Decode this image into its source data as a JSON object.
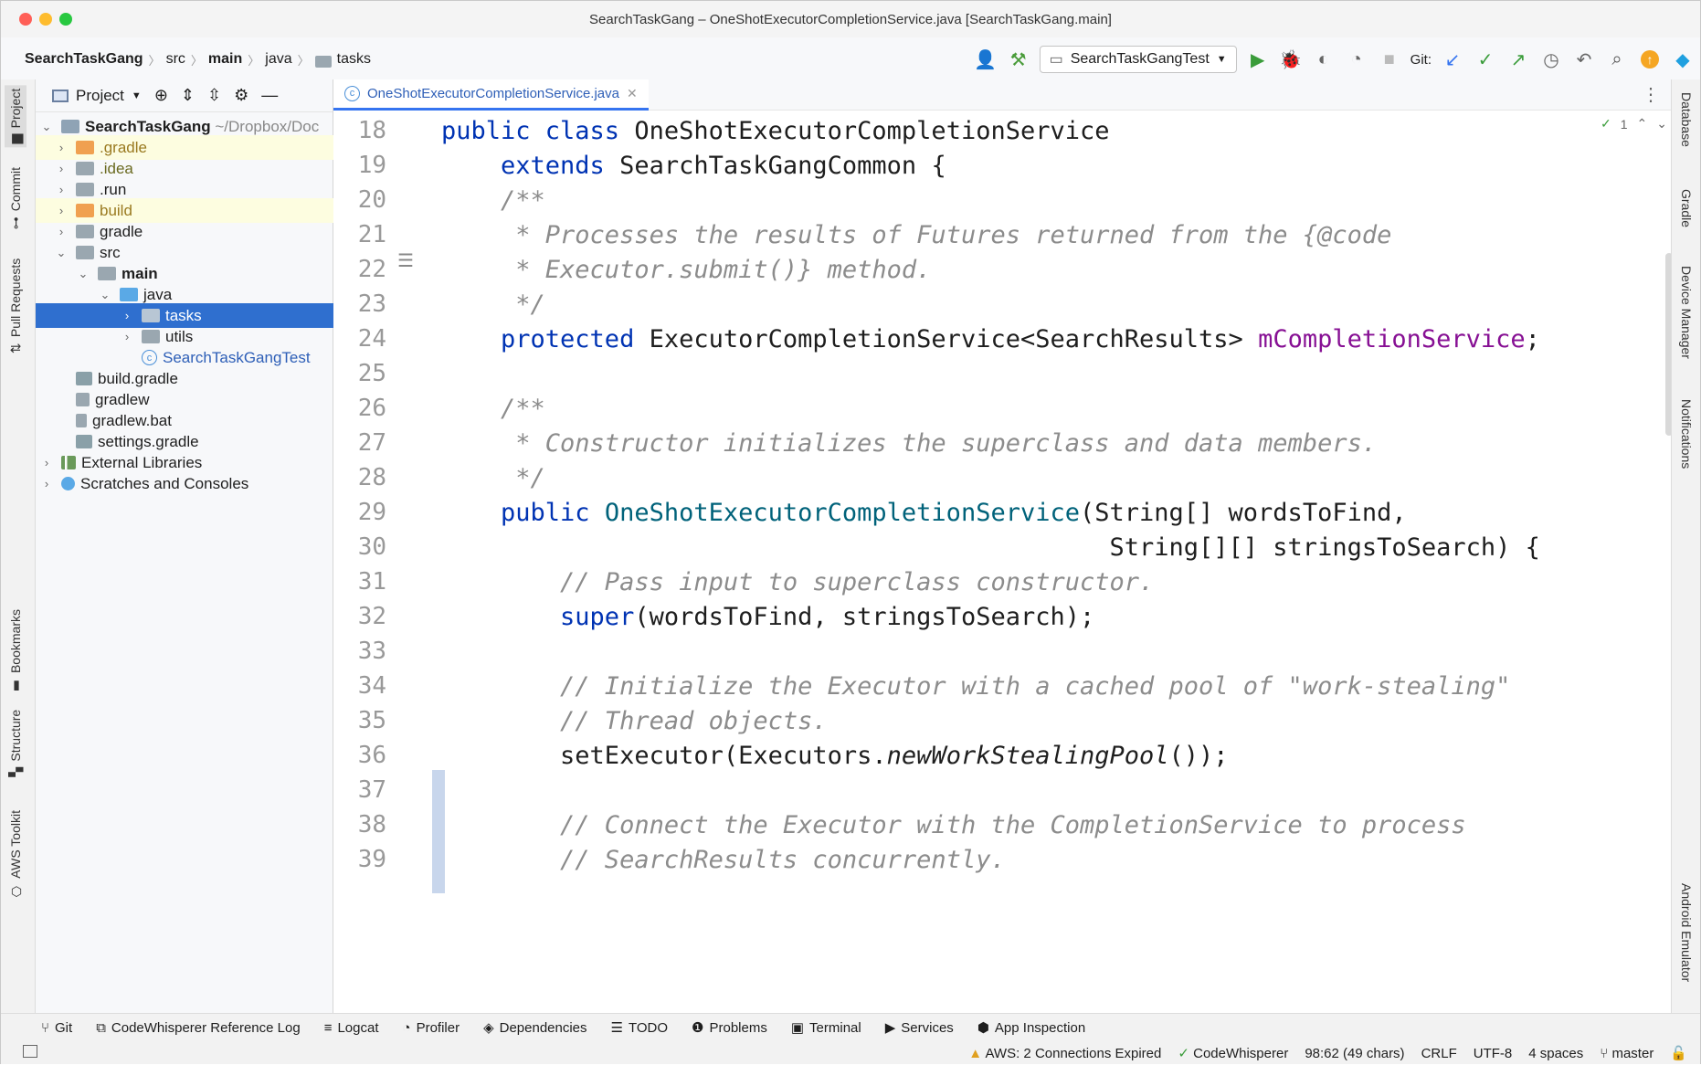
{
  "window": {
    "title": "SearchTaskGang – OneShotExecutorCompletionService.java [SearchTaskGang.main]"
  },
  "breadcrumbs": [
    "SearchTaskGang",
    "src",
    "main",
    "java",
    "tasks"
  ],
  "toolbar": {
    "run_config": "SearchTaskGangTest",
    "git_label": "Git:"
  },
  "project_panel": {
    "title": "Project",
    "root_name": "SearchTaskGang",
    "root_path": "~/Dropbox/Doc",
    "items": [
      ".gradle",
      ".idea",
      ".run",
      "build",
      "gradle",
      "src",
      "main",
      "java",
      "tasks",
      "utils",
      "SearchTaskGangTest",
      "build.gradle",
      "gradlew",
      "gradlew.bat",
      "settings.gradle",
      "External Libraries",
      "Scratches and Consoles"
    ]
  },
  "left_tabs": [
    "Project",
    "Commit",
    "Pull Requests",
    "Bookmarks",
    "Structure",
    "AWS Toolkit"
  ],
  "right_tabs": [
    "Database",
    "Gradle",
    "Device Manager",
    "Notifications",
    "Android Emulator"
  ],
  "editor": {
    "tab_title": "OneShotExecutorCompletionService.java",
    "inspection_count": "1",
    "line_numbers": [
      "18",
      "19",
      "20",
      "21",
      "22",
      "23",
      "24",
      "25",
      "26",
      "27",
      "28",
      "29",
      "30",
      "31",
      "32",
      "33",
      "34",
      "35",
      "36",
      "37",
      "38",
      "39"
    ]
  },
  "code": {
    "l18a": "public class ",
    "l18b": "OneShotExecutorCompletionService",
    "l19a": "    extends ",
    "l19b": "SearchTaskGangCommon {",
    "l20": "    /**",
    "l21": "     * Processes the results of Futures returned from the {@code",
    "l22": "     * Executor.submit()} method.",
    "l23": "     */",
    "l24a": "    protected ",
    "l24b": "ExecutorCompletionService<SearchResults> ",
    "l24c": "mCompletionService",
    "l24d": ";",
    "l26": "    /**",
    "l27": "     * Constructor initializes the superclass and data members.",
    "l28": "     */",
    "l29a": "    public ",
    "l29b": "OneShotExecutorCompletionService",
    "l29c": "(String[] wordsToFind,",
    "l30": "                                             String[][] stringsToSearch) {",
    "l31": "        // Pass input to superclass constructor.",
    "l32a": "        super",
    "l32b": "(wordsToFind, stringsToSearch);",
    "l34": "        // Initialize the Executor with a cached pool of \"work-stealing\"",
    "l35": "        // Thread objects.",
    "l36a": "        setExecutor(Executors.",
    "l36b": "newWorkStealingPool",
    "l36c": "());",
    "l38": "        // Connect the Executor with the CompletionService to process",
    "l39": "        // SearchResults concurrently."
  },
  "tool_windows": [
    "Git",
    "CodeWhisperer Reference Log",
    "Logcat",
    "Profiler",
    "Dependencies",
    "TODO",
    "Problems",
    "Terminal",
    "Services",
    "App Inspection"
  ],
  "status": {
    "aws": "AWS: 2 Connections Expired",
    "codewhisperer": "CodeWhisperer",
    "position": "98:62 (49 chars)",
    "line_sep": "CRLF",
    "encoding": "UTF-8",
    "indent": "4 spaces",
    "branch": "master"
  }
}
